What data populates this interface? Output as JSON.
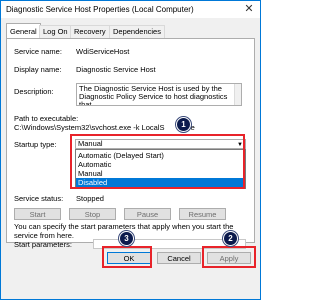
{
  "window": {
    "title": "Diagnostic Service Host Properties (Local Computer)",
    "close_glyph": "✕"
  },
  "tabs": [
    {
      "label": "General"
    },
    {
      "label": "Log On"
    },
    {
      "label": "Recovery"
    },
    {
      "label": "Dependencies"
    }
  ],
  "general": {
    "service_name_label": "Service name:",
    "service_name": "WdiServiceHost",
    "display_name_label": "Display name:",
    "display_name": "Diagnostic Service Host",
    "description_label": "Description:",
    "description": "The Diagnostic Service Host is used by the Diagnostic Policy Service to host diagnostics that",
    "path_label": "Path to executable:",
    "path_prefix": "C:\\Windows\\System32\\svchost.exe -k LocalS",
    "path_suffix": "vice",
    "startup_type_label": "Startup type:",
    "startup_type_value": "Manual",
    "startup_options": [
      "Automatic (Delayed Start)",
      "Automatic",
      "Manual",
      "Disabled"
    ],
    "selected_option_index": 3,
    "service_status_label": "Service status:",
    "service_status_value": "Stopped",
    "buttons": {
      "start": "Start",
      "stop": "Stop",
      "pause": "Pause",
      "resume": "Resume"
    },
    "hint": "You can specify the start parameters that apply when you start the service from here.",
    "start_params_label": "Start parameters:"
  },
  "footer": {
    "ok": "OK",
    "cancel": "Cancel",
    "apply": "Apply"
  },
  "annotations": {
    "badge1": "1",
    "badge2": "2",
    "badge3": "3"
  },
  "colors": {
    "highlight": "#e8232a",
    "selection": "#0078d7",
    "badge": "#0b1a4d"
  }
}
